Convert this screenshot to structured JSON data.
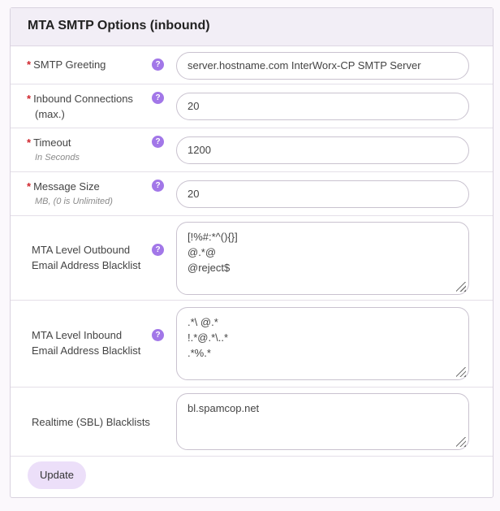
{
  "panel": {
    "title": "MTA SMTP Options (inbound)"
  },
  "required_mark": "*",
  "help_glyph": "?",
  "fields": {
    "smtp_greeting": {
      "label": "SMTP Greeting",
      "value": "server.hostname.com InterWorx-CP SMTP Server"
    },
    "inbound_connections": {
      "label_line1": "Inbound Connections",
      "label_line2": "(max.)",
      "value": "20"
    },
    "timeout": {
      "label": "Timeout",
      "sublabel": "In Seconds",
      "value": "1200"
    },
    "message_size": {
      "label": "Message Size",
      "sublabel": "MB, (0 is Unlimited)",
      "value": "20"
    },
    "outbound_blacklist": {
      "label_line1": "MTA Level Outbound",
      "label_line2": "Email Address Blacklist",
      "lines": [
        "[!%#:*^(){}]",
        "@.*@",
        "@reject$"
      ]
    },
    "inbound_blacklist": {
      "label_line1": "MTA Level Inbound",
      "label_line2": "Email Address Blacklist",
      "lines": [
        ".*\\ @.*",
        "!.*@.*\\..*",
        ".*%.*"
      ]
    },
    "sbl_blacklists": {
      "label": "Realtime (SBL) Blacklists",
      "lines": [
        "bl.spamcop.net"
      ]
    }
  },
  "buttons": {
    "update": "Update"
  },
  "colors": {
    "help_icon": "#a277e8",
    "required": "#d0262d",
    "button_bg": "#ecdff9",
    "header_bg": "#f2eef6"
  }
}
